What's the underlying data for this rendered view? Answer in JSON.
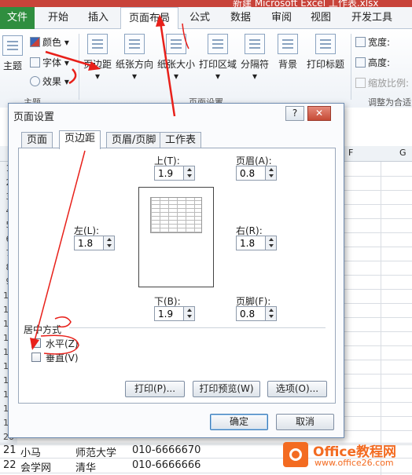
{
  "window": {
    "title": "新建 Microsoft Excel 工作表.xlsx"
  },
  "ribbon_tabs": [
    "文件",
    "开始",
    "插入",
    "页面布局",
    "公式",
    "数据",
    "审阅",
    "视图",
    "开发工具"
  ],
  "ribbon": {
    "theme_small": [
      "颜色",
      "字体",
      "效果"
    ],
    "theme_big": "主题",
    "buttons": [
      "页边距",
      "纸张方向",
      "纸张大小",
      "打印区域",
      "分隔符",
      "背景",
      "打印标题"
    ],
    "scale": [
      "宽度:",
      "高度:",
      "缩放比例:"
    ],
    "groups": [
      "主题",
      "页面设置",
      "调整为合适"
    ]
  },
  "sheet": {
    "col_headers": [
      "F",
      "G"
    ],
    "row_numbers": [
      "1",
      "2",
      "3",
      "4",
      "5",
      "6",
      "7",
      "8",
      "9",
      "10",
      "11",
      "12",
      "13",
      "14",
      "15",
      "16",
      "17",
      "18",
      "19",
      "20",
      "21",
      "22"
    ],
    "rows": [
      {
        "num": "21",
        "a": "小马",
        "b": "师范大学",
        "c": "010-6666670"
      },
      {
        "num": "22",
        "a": "会学网",
        "b": "清华",
        "c": "010-6666666"
      }
    ]
  },
  "dialog": {
    "title": "页面设置",
    "help": "?",
    "close": "✕",
    "tabs": [
      "页面",
      "页边距",
      "页眉/页脚",
      "工作表"
    ],
    "top_label": "上(T):",
    "top_value": "1.9",
    "header_label": "页眉(A):",
    "header_value": "0.8",
    "left_label": "左(L):",
    "left_value": "1.8",
    "right_label": "右(R):",
    "right_value": "1.8",
    "bottom_label": "下(B):",
    "bottom_value": "1.9",
    "footer_label": "页脚(F):",
    "footer_value": "0.8",
    "center_label": "居中方式",
    "horizontal_label": "水平(Z)",
    "vertical_label": "垂直(V)",
    "print_button": "打印(P)...",
    "preview_button": "打印预览(W)",
    "options_button": "选项(O)...",
    "ok_button": "确定",
    "cancel_button": "取消"
  },
  "watermark": {
    "brand": "Office教程网",
    "url": "www.office26.com"
  },
  "colors": {
    "file_tab": "#2f8e3f",
    "title_bar": "#c8433a",
    "annotation": "#e8201a",
    "logo": "#f36b21"
  }
}
